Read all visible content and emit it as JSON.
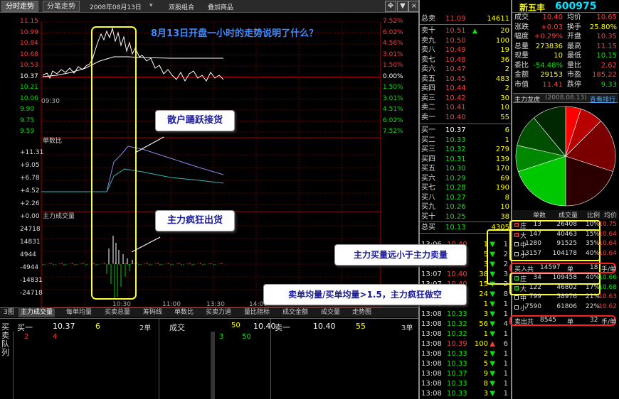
{
  "toolbar": {
    "tab1": "分时走势",
    "tab2": "分笔走势",
    "date": "2008年08月13日",
    "menu1": "双股组合",
    "menu2": "叠加商品",
    "nav_left": "◀▶",
    "nav_right": "▼",
    "nav_close": "×"
  },
  "stock": {
    "name": "新五丰",
    "code": "600975"
  },
  "chart_title": "8月13日开盘一小时的走势说明了什么？",
  "price_axis": [
    "11.15",
    "10.99",
    "10.84",
    "10.68",
    "10.53",
    "10.37",
    "10.21",
    "10.06",
    "9.90",
    "9.75",
    "9.59"
  ],
  "pct_axis": [
    "7.52%",
    "6.02%",
    "4.56%",
    "3.01%",
    "1.50%",
    "0.00%",
    "1.50%",
    "3.01%",
    "4.51%",
    "6.02%",
    "7.52%"
  ],
  "time_axis": [
    "09:30",
    "10:30",
    "11:00",
    "13:30",
    "14:00"
  ],
  "ratio_panel": {
    "title": "单数比",
    "ticks": [
      "+11.31",
      "+9.05",
      "+6.78",
      "+4.52",
      "+2.26",
      "+0.00"
    ]
  },
  "volume_panel": {
    "title": "主力成交量",
    "ticks": [
      "24718",
      "14831",
      "4944",
      "-4944",
      "-14831",
      "-24718"
    ]
  },
  "bottom_tabs": [
    "3图",
    "主力成交量",
    "每单均量",
    "买卖总量",
    "筹码线",
    "单数比",
    "买卖力道",
    "量比指标",
    "成交金额",
    "成交量",
    "走势图"
  ],
  "callouts": {
    "retail": "散户踊跃接货",
    "main": "主力疯狂出货",
    "buy_less": "主力买量远小于主力卖量",
    "ratio": "卖单均量/买单均量>1.5，主力疯狂做空"
  },
  "bottom_quote": {
    "buy_label": "买一",
    "buy_price": "10.37",
    "buy_vol": "6",
    "buy_count": "2单",
    "deal_label": "成交",
    "deal_price": "10.40",
    "deal_count": "50",
    "sell_label": "卖一",
    "sell_price": "10.40",
    "sell_vol": "55",
    "sell_count": "3单",
    "queue_label": "买卖队列",
    "queue_buy": [
      "2",
      "4"
    ],
    "queue_deal": [
      "3",
      "50"
    ]
  },
  "order_book": {
    "total_sell": {
      "label": "总卖",
      "price": "11.09",
      "vol": "14611"
    },
    "sells": [
      {
        "label": "卖十",
        "price": "10.51",
        "mark": "▲",
        "vol": "20"
      },
      {
        "label": "卖九",
        "price": "10.50",
        "mark": "",
        "vol": "100"
      },
      {
        "label": "卖八",
        "price": "10.49",
        "mark": "",
        "vol": "19"
      },
      {
        "label": "卖七",
        "price": "10.48",
        "mark": "",
        "vol": "36"
      },
      {
        "label": "卖六",
        "price": "10.47",
        "mark": "",
        "vol": "2"
      },
      {
        "label": "卖五",
        "price": "10.45",
        "mark": "",
        "vol": "483"
      },
      {
        "label": "卖四",
        "price": "10.44",
        "mark": "",
        "vol": "2"
      },
      {
        "label": "卖三",
        "price": "10.42",
        "mark": "",
        "vol": "30"
      },
      {
        "label": "卖二",
        "price": "10.41",
        "mark": "",
        "vol": "10"
      },
      {
        "label": "卖一",
        "price": "10.40",
        "mark": "",
        "vol": "55"
      }
    ],
    "buys": [
      {
        "label": "买一",
        "price": "10.37",
        "vol": "6"
      },
      {
        "label": "买二",
        "price": "10.33",
        "vol": "1"
      },
      {
        "label": "买三",
        "price": "10.32",
        "vol": "279"
      },
      {
        "label": "买四",
        "price": "10.31",
        "vol": "139"
      },
      {
        "label": "买五",
        "price": "10.30",
        "vol": "170"
      },
      {
        "label": "买六",
        "price": "10.29",
        "vol": "69"
      },
      {
        "label": "买七",
        "price": "10.28",
        "vol": "190"
      },
      {
        "label": "买八",
        "price": "10.27",
        "vol": "8"
      },
      {
        "label": "买九",
        "price": "10.26",
        "vol": "10"
      },
      {
        "label": "买十",
        "price": "10.25",
        "vol": "38"
      }
    ],
    "total_buy": {
      "label": "总买",
      "price": "10.13",
      "vol": "4305"
    }
  },
  "stats": [
    {
      "l1": "成交",
      "v1": "10.40",
      "l2": "均价",
      "v2": "10.65"
    },
    {
      "l1": "涨跌",
      "v1": "+0.03",
      "l2": "换手",
      "v2": "25.80%"
    },
    {
      "l1": "幅度",
      "v1": "+0.29%",
      "l2": "开盘",
      "v2": "10.35"
    },
    {
      "l1": "总量",
      "v1": "273836",
      "l2": "最高",
      "v2": "11.15"
    },
    {
      "l1": "现量",
      "v1": "10",
      "l2": "最低",
      "v2": "10.15"
    },
    {
      "l1": "委比",
      "v1": "-54.48%",
      "l2": "量比",
      "v2": "2.62"
    },
    {
      "l1": "金额",
      "v1": "29153",
      "l2": "市盈",
      "v2": "185.22"
    },
    {
      "l1": "市值",
      "v1": "11.41",
      "l2": "跌停",
      "v2": "9.33"
    }
  ],
  "dragon": {
    "title": "主力龙虎",
    "date": "(2008.08.13)",
    "link": "查看排行"
  },
  "pie_data": {
    "slices": [
      {
        "value": 10,
        "color": "#ff0000"
      },
      {
        "value": 15,
        "color": "#b80000"
      },
      {
        "value": 35,
        "color": "#7a0000"
      },
      {
        "value": 40,
        "color": "#2d0000"
      },
      {
        "value": 40,
        "color": "#00c800"
      },
      {
        "value": 17,
        "color": "#008800"
      },
      {
        "value": 21,
        "color": "#004e00"
      },
      {
        "value": 22,
        "color": "#002800"
      }
    ]
  },
  "big_table": {
    "headers": [
      "单数",
      "成交量",
      "比例",
      "均价"
    ],
    "rows": [
      {
        "type": "庄",
        "count": "13",
        "vol": "26408",
        "pct": "10%",
        "avg": "10.75",
        "c": "red"
      },
      {
        "type": "大",
        "count": "147",
        "vol": "40463",
        "pct": "15%",
        "avg": "10.64",
        "c": "red"
      },
      {
        "type": "中",
        "count": "1280",
        "vol": "91525",
        "pct": "35%",
        "avg": "10.64",
        "c": "gray"
      },
      {
        "type": "小",
        "count": "13157",
        "vol": "104178",
        "pct": "40%",
        "avg": "10.64",
        "c": "gray"
      }
    ],
    "buy_total": {
      "label": "买入共",
      "vol": "14597",
      "unit": "单",
      "avg": "18",
      "unit2": "手/单"
    },
    "rows2": [
      {
        "type": "庄",
        "count": "34",
        "vol": "109458",
        "pct": "40%",
        "avg": "10.66",
        "c": "green"
      },
      {
        "type": "大",
        "count": "122",
        "vol": "46802",
        "pct": "17%",
        "avg": "10.68",
        "c": "green"
      },
      {
        "type": "中",
        "count": "799",
        "vol": "58976",
        "pct": "21%",
        "avg": "10.63",
        "c": "gray"
      },
      {
        "type": "小",
        "count": "7590",
        "vol": "61806",
        "pct": "22%",
        "avg": "10.62",
        "c": "gray"
      }
    ],
    "sell_total": {
      "label": "卖出共",
      "vol": "8545",
      "unit": "单",
      "avg": "32",
      "unit2": "手/单"
    }
  },
  "ticks": [
    {
      "t": "13:06",
      "p": "10.40",
      "v": "1",
      "d": "▼",
      "n": "1"
    },
    {
      "t": "13:06",
      "p": "10.40",
      "v": "5",
      "d": "▼",
      "n": "2"
    },
    {
      "t": "13:06",
      "p": "10.40",
      "v": "3",
      "d": "▼",
      "n": "2"
    },
    {
      "t": "13:07",
      "p": "10.40",
      "v": "38",
      "d": "▼",
      "n": "3"
    },
    {
      "t": "13:07",
      "p": "10.40",
      "v": "15",
      "d": "▼",
      "n": "2"
    },
    {
      "t": "13:08",
      "p": "10.40",
      "v": "24",
      "d": "▼",
      "n": "8"
    },
    {
      "t": "13:08",
      "p": "10.40",
      "v": "1",
      "d": "▼",
      "n": "1"
    },
    {
      "t": "13:08",
      "p": "10.33",
      "v": "3",
      "d": "▼",
      "n": "1"
    },
    {
      "t": "13:08",
      "p": "10.32",
      "v": "56",
      "d": "▼",
      "n": "4"
    },
    {
      "t": "13:08",
      "p": "10.32",
      "v": "1",
      "d": "▼",
      "n": "1"
    },
    {
      "t": "13:08",
      "p": "10.39",
      "v": "100",
      "d": "▲",
      "n": "6"
    },
    {
      "t": "13:08",
      "p": "10.33",
      "v": "2",
      "d": "▼",
      "n": "1"
    },
    {
      "t": "13:08",
      "p": "10.33",
      "v": "5",
      "d": "▼",
      "n": "1"
    },
    {
      "t": "13:08",
      "p": "10.37",
      "v": "9",
      "d": "▼",
      "n": "1"
    },
    {
      "t": "13:08",
      "p": "10.33",
      "v": "8",
      "d": "▼",
      "n": "1"
    },
    {
      "t": "13:08",
      "p": "10.33",
      "v": "3",
      "d": "▼",
      "n": "1"
    }
  ]
}
